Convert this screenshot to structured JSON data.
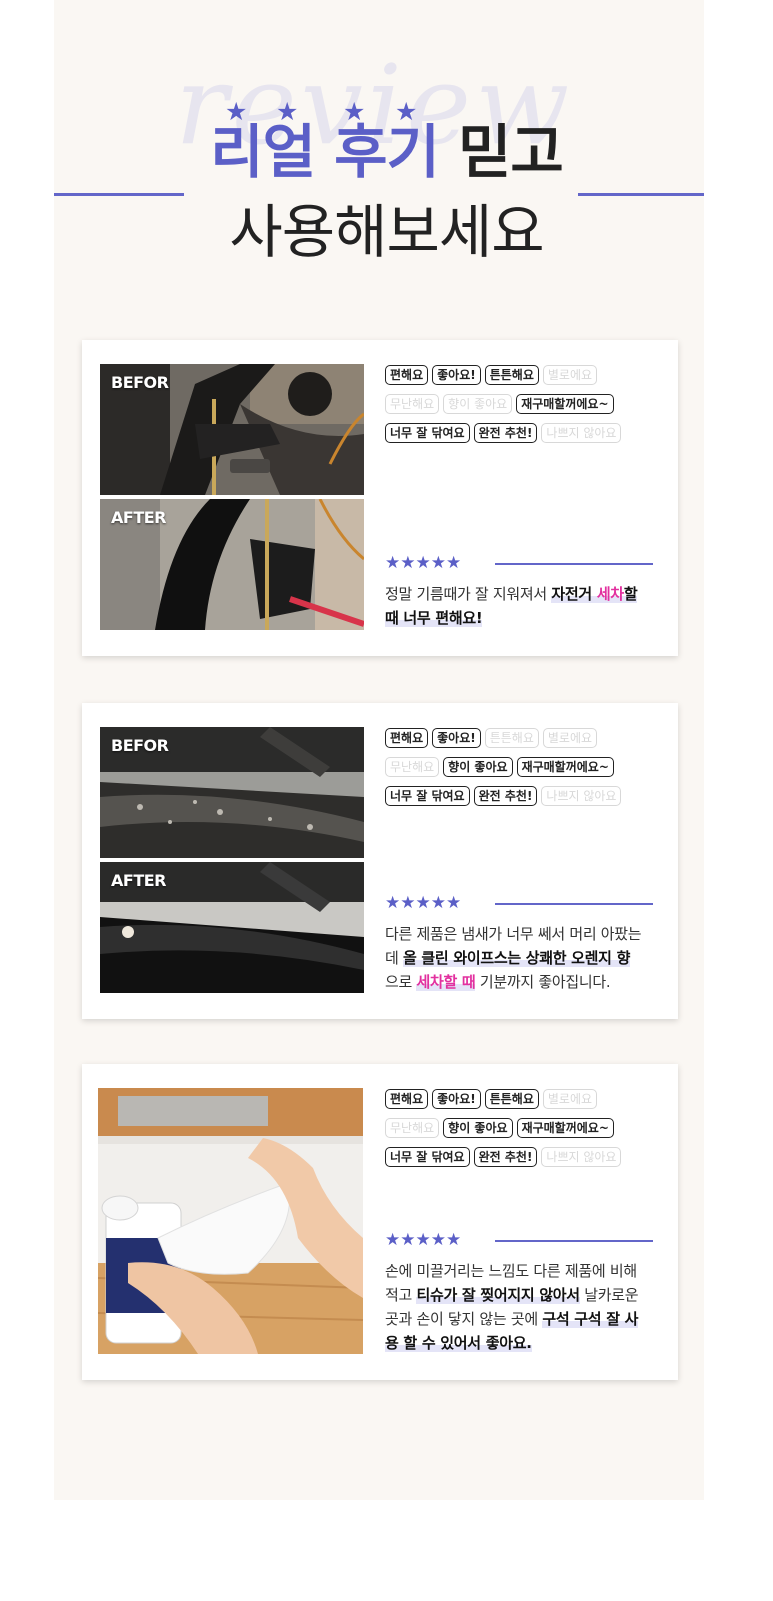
{
  "header": {
    "watermark": "review",
    "title_highlight": "리얼 후기",
    "title_rest": "믿고",
    "subtitle": "사용해보세요",
    "star_glyph": "★",
    "accent_color": "#5b5fc7"
  },
  "cards": [
    {
      "labels": {
        "before": "BEFOR",
        "after": "AFTER"
      },
      "tags": [
        [
          {
            "t": "편해요",
            "on": true
          },
          {
            "t": "좋아요!",
            "on": true
          },
          {
            "t": "튼튼해요",
            "on": true
          },
          {
            "t": "별로에요",
            "on": false
          }
        ],
        [
          {
            "t": "무난해요",
            "on": false
          },
          {
            "t": "향이 좋아요",
            "on": false
          },
          {
            "t": "재구매할꺼에요~",
            "on": true
          }
        ],
        [
          {
            "t": "너무 잘 닦여요",
            "on": true
          },
          {
            "t": "완전 추천!",
            "on": true
          },
          {
            "t": "나쁘지 않아요",
            "on": false
          }
        ]
      ],
      "stars": "★★★★★",
      "review": {
        "l1_plain": "정말 기름때가 잘 지워져서 ",
        "l1_bold": "자전거 ",
        "l1_pink": "세차",
        "l1_bold2": "할",
        "l2_bold": "때 너무 편해요!"
      }
    },
    {
      "labels": {
        "before": "BEFOR",
        "after": "AFTER"
      },
      "tags": [
        [
          {
            "t": "편해요",
            "on": true
          },
          {
            "t": "좋아요!",
            "on": true
          },
          {
            "t": "튼튼해요",
            "on": false
          },
          {
            "t": "별로에요",
            "on": false
          }
        ],
        [
          {
            "t": "무난해요",
            "on": false
          },
          {
            "t": "향이 좋아요",
            "on": true
          },
          {
            "t": "재구매할꺼에요~",
            "on": true
          }
        ],
        [
          {
            "t": "너무 잘 닦여요",
            "on": true
          },
          {
            "t": "완전 추천!",
            "on": true
          },
          {
            "t": "나쁘지 않아요",
            "on": false
          }
        ]
      ],
      "stars": "★★★★★",
      "review": {
        "l1": "다른 제품은 냄새가 너무 쎄서 머리 아팠는",
        "l2_plain": "데 ",
        "l2_bold": "올 클린 와이프스는 상쾌한 오렌지 향",
        "l3_plain": "으로 ",
        "l3_pink": "세차할 때",
        "l3_rest": " 기분까지 좋아집니다."
      }
    },
    {
      "tags": [
        [
          {
            "t": "편해요",
            "on": true
          },
          {
            "t": "좋아요!",
            "on": true
          },
          {
            "t": "튼튼해요",
            "on": true
          },
          {
            "t": "별로에요",
            "on": false
          }
        ],
        [
          {
            "t": "무난해요",
            "on": false
          },
          {
            "t": "향이 좋아요",
            "on": true
          },
          {
            "t": "재구매할꺼에요~",
            "on": true
          }
        ],
        [
          {
            "t": "너무 잘 닦여요",
            "on": true
          },
          {
            "t": "완전 추천!",
            "on": true
          },
          {
            "t": "나쁘지 않아요",
            "on": false
          }
        ]
      ],
      "stars": "★★★★★",
      "review": {
        "l1": "손에 미끌거리는 느낌도 다른 제품에 비해",
        "l2_plain": "적고 ",
        "l2_bold": "티슈가 잘 찢어지지 않아서",
        "l2_rest": " 날카로운",
        "l3_plain": "곳과 손이 닿지 않는 곳에 ",
        "l3_bold": "구석 구석 잘 사",
        "l4_bold": "용 할 수 있어서 좋아요."
      }
    }
  ]
}
